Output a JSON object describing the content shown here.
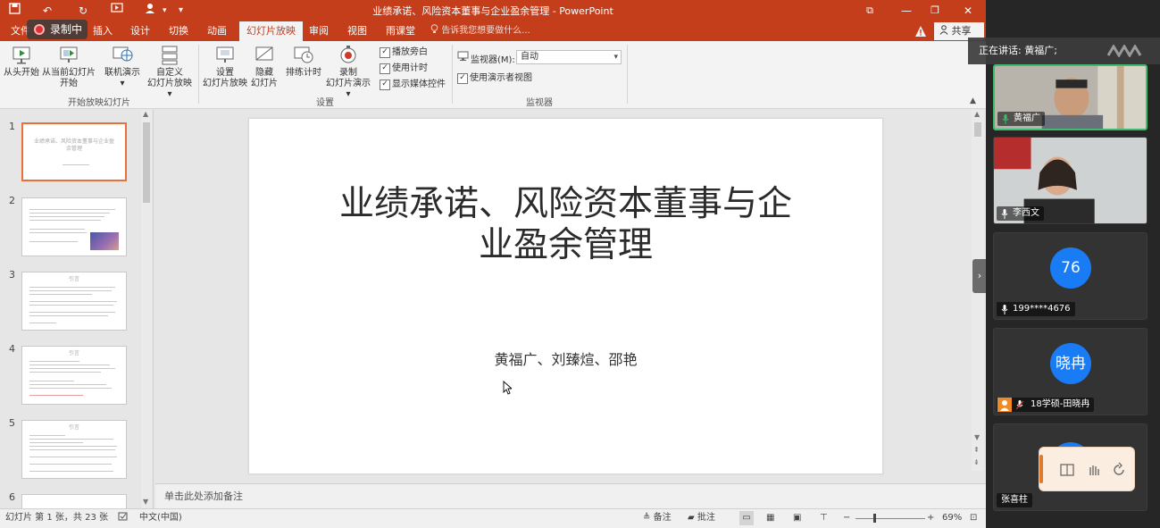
{
  "window": {
    "title": "业绩承诺、风险资本董事与企业盈余管理 - PowerPoint",
    "file_tab": "文件"
  },
  "recording": {
    "label": "录制中"
  },
  "tabs": [
    "插入",
    "设计",
    "切换",
    "动画",
    "幻灯片放映",
    "审阅",
    "视图",
    "雨课堂"
  ],
  "active_tab": "幻灯片放映",
  "tell_me": "告诉我您想要做什么...",
  "share_label": "共享",
  "ribbon": {
    "buttons": {
      "from_beginning": "从头开始",
      "from_current_1": "从当前幻灯片",
      "from_current_2": "开始",
      "online_1": "联机演示",
      "online_2": "▾",
      "custom_1": "自定义",
      "custom_2": "幻灯片放映 ▾",
      "setup_1": "设置",
      "setup_2": "幻灯片放映",
      "hide_1": "隐藏",
      "hide_2": "幻灯片",
      "rehearse": "排练计时",
      "record_1": "录制",
      "record_2": "幻灯片演示 ▾"
    },
    "checkboxes": {
      "play_narration": "播放旁白",
      "use_timings": "使用计时",
      "show_media_controls": "显示媒体控件",
      "use_presenter_view": "使用演示者视图"
    },
    "monitor_label": "监视器(M):",
    "monitor_value": "自动",
    "groups": {
      "start": "开始放映幻灯片",
      "setup": "设置",
      "monitors": "监视器"
    }
  },
  "thumbnails": {
    "numbers": [
      "1",
      "2",
      "3",
      "4",
      "5",
      "6"
    ],
    "title_1": "业绩承诺、风险资本董事与企业盈余管理",
    "heading": "引言"
  },
  "slide": {
    "title_line1": "业绩承诺、风险资本董事与企",
    "title_line2": "业盈余管理",
    "authors": "黄福广、刘臻煊、邵艳"
  },
  "notes_placeholder": "单击此处添加备注",
  "status": {
    "slide_info": "幻灯片 第 1 张，共 23 张",
    "language": "中文(中国)",
    "notes": "备注",
    "comments": "批注",
    "zoom": "69%"
  },
  "meeting": {
    "speaking": "正在讲话: 黄福广;",
    "participants": [
      {
        "name": "黄福广",
        "avatar": "",
        "type": "video"
      },
      {
        "name": "李西文",
        "avatar": "",
        "type": "video"
      },
      {
        "name": "199****4676",
        "avatar": "76",
        "type": "avatar"
      },
      {
        "name": "18学硕-田晓冉",
        "avatar": "晓冉",
        "type": "avatar"
      },
      {
        "name": "张喜柱",
        "avatar": "",
        "type": "avatar"
      }
    ]
  },
  "colors": {
    "ppt_accent": "#c43e1c",
    "avatar_blue": "#1a7cf5",
    "active_speaker": "#3dbd6e"
  }
}
